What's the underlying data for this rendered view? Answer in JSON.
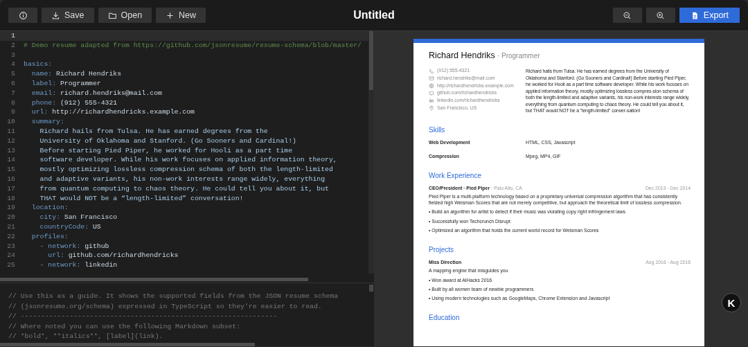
{
  "toolbar": {
    "left_buttons": [
      {
        "kind": "info"
      },
      {
        "kind": "save",
        "label": "Save"
      },
      {
        "kind": "open",
        "label": "Open"
      },
      {
        "kind": "new",
        "label": "New"
      }
    ],
    "title": "Untitled",
    "right_buttons": [
      {
        "kind": "zoom-out"
      },
      {
        "kind": "zoom-in"
      },
      {
        "kind": "export",
        "label": "Export"
      }
    ]
  },
  "editor": {
    "lines": [
      {
        "number": "1",
        "kind": "blank",
        "active": true
      },
      {
        "number": "2",
        "kind": "comment",
        "text": "# Demo resume adapted from https://github.com/jsonresume/resume-schema/blob/master/",
        "active": false
      },
      {
        "number": "3",
        "kind": "blank",
        "active": false
      },
      {
        "number": "4",
        "kind": "key",
        "key": "basics:",
        "active": false
      },
      {
        "number": "5",
        "kind": "key",
        "key": "  name:",
        "value": " Richard Hendriks",
        "active": false
      },
      {
        "number": "6",
        "kind": "key",
        "key": "  label:",
        "value": " Programmer",
        "active": false
      },
      {
        "number": "7",
        "kind": "key",
        "key": "  email:",
        "value": " richard.hendriks@mail.com",
        "active": false
      },
      {
        "number": "8",
        "kind": "key",
        "key": "  phone:",
        "value": " (912) 555-4321",
        "active": false
      },
      {
        "number": "9",
        "kind": "key",
        "key": "  url:",
        "value": " http://richardhendricks.example.com",
        "active": false
      },
      {
        "number": "10",
        "kind": "key",
        "key": "  summary:",
        "active": false
      },
      {
        "number": "11",
        "kind": "text",
        "text": "    Richard hails from Tulsa. He has earned degrees from the",
        "active": false
      },
      {
        "number": "12",
        "kind": "text",
        "text": "    University of Oklahoma and Stanford. (Go Sooners and Cardinal!)",
        "active": false
      },
      {
        "number": "13",
        "kind": "text",
        "text": "    Before starting Pied Piper, he worked for Hooli as a part time",
        "active": false
      },
      {
        "number": "14",
        "kind": "text",
        "text": "    software developer. While his work focuses on applied information theory,",
        "active": false
      },
      {
        "number": "15",
        "kind": "text",
        "text": "    mostly optimizing lossless compression schema of both the length-limited",
        "active": false
      },
      {
        "number": "16",
        "kind": "text",
        "text": "    and adaptive variants, his non-work interests range widely, everything",
        "active": false
      },
      {
        "number": "17",
        "kind": "text",
        "text": "    from quantum computing to chaos theory. He could tell you about it, but",
        "active": false
      },
      {
        "number": "18",
        "kind": "text",
        "text": "    THAT would NOT be a “length-limited” conversation!",
        "active": false
      },
      {
        "number": "19",
        "kind": "key",
        "key": "  location:",
        "active": false
      },
      {
        "number": "20",
        "kind": "key",
        "key": "    city:",
        "value": " San Francisco",
        "active": false
      },
      {
        "number": "21",
        "kind": "key",
        "key": "    countryCode:",
        "value": " US",
        "active": false
      },
      {
        "number": "22",
        "kind": "key",
        "key": "  profiles:",
        "active": false
      },
      {
        "number": "23",
        "kind": "key",
        "key": "    - network:",
        "value": " github",
        "active": false
      },
      {
        "number": "24",
        "kind": "key",
        "key": "      url:",
        "value": " github.com/richardhendricks",
        "active": false
      },
      {
        "number": "25",
        "kind": "key",
        "key": "    - network:",
        "value": " linkedin",
        "active": false
      }
    ]
  },
  "guide": {
    "lines": [
      "// Use this as a guide. It shows the supported fields from the JSON resume schema",
      "// (jsonresume.org/schema) expressed in TypeScript so they're easier to read.",
      "// ---------------------------------------------------------------",
      "// Where noted you can use the following Markdown subset:",
      "// *bold*, **italics**, [label](link)."
    ]
  },
  "resume": {
    "name": "Richard Hendriks",
    "label": "· Programmer",
    "contacts": [
      {
        "kind": "phone",
        "text": "(912) 555-4321"
      },
      {
        "kind": "email",
        "text": "richard.hendriks@mail.com"
      },
      {
        "kind": "web",
        "text": "http://richardhendricks.example.com"
      },
      {
        "kind": "github",
        "text": "github.com/richardhendricks"
      },
      {
        "kind": "linkedin",
        "text": "linkedin.com/richardhendricks"
      },
      {
        "kind": "location",
        "text": "San Francisco, US"
      }
    ],
    "summary": "Richard hails from Tulsa. He has earned degrees from the University of Oklahoma and Stanford. (Go Sooners and Cardinal!) Before starting Pied Piper, he worked for Hooli as a part time software developer. While his work focuses on applied information theory, mostly optimizing lossless compres-sion schema of both the length-limited and adaptive variants, his non-work interests range widely, everything from quantum computing to chaos theory. He could tell you about it, but THAT would NOT be a \"length-limited\" conver-sation!",
    "sections": [
      {
        "kind": "skills",
        "title": "Skills",
        "rows": [
          {
            "name": "Web Development",
            "keywords": "HTML, CSS, Javascript"
          },
          {
            "name": "Compression",
            "keywords": "Mpeg, MP4, GIF"
          }
        ]
      },
      {
        "kind": "entries",
        "title": "Work Experience",
        "entries": [
          {
            "heading": "CEO/President · Pied Piper",
            "location": "· Palo Alto, CA",
            "dates": "Dec 2013 - Dec 2014",
            "summary": "Pied Piper is a multi-platform technology based on a proprietary universal compression algorithm that has consistently fielded high Weisman Scores that are not merely competitive, but approach the theoretical limit of lossless compression.",
            "highlights": [
              "• Build an algorithm for artist to detect if their music was violating copy right infringement laws",
              "• Successfully won Techcrunch Disrupt",
              "• Optimized an algorithm that holds the current world record for Weisman Scores"
            ]
          }
        ]
      },
      {
        "kind": "entries",
        "title": "Projects",
        "entries": [
          {
            "heading": "Miss Direction",
            "dates": "Aug 2016 - Aug 2016",
            "summary": "A mapping engine that misguides you",
            "highlights": [
              "• Won award at AIHacks 2016",
              "• Built by all women team of newbie programmers",
              "• Using modern technologies such as GoogleMaps, Chrome Extension and Javascript"
            ]
          }
        ]
      },
      {
        "kind": "title-only",
        "title": "Education"
      }
    ]
  },
  "floating_badge": {
    "letter": "K"
  }
}
